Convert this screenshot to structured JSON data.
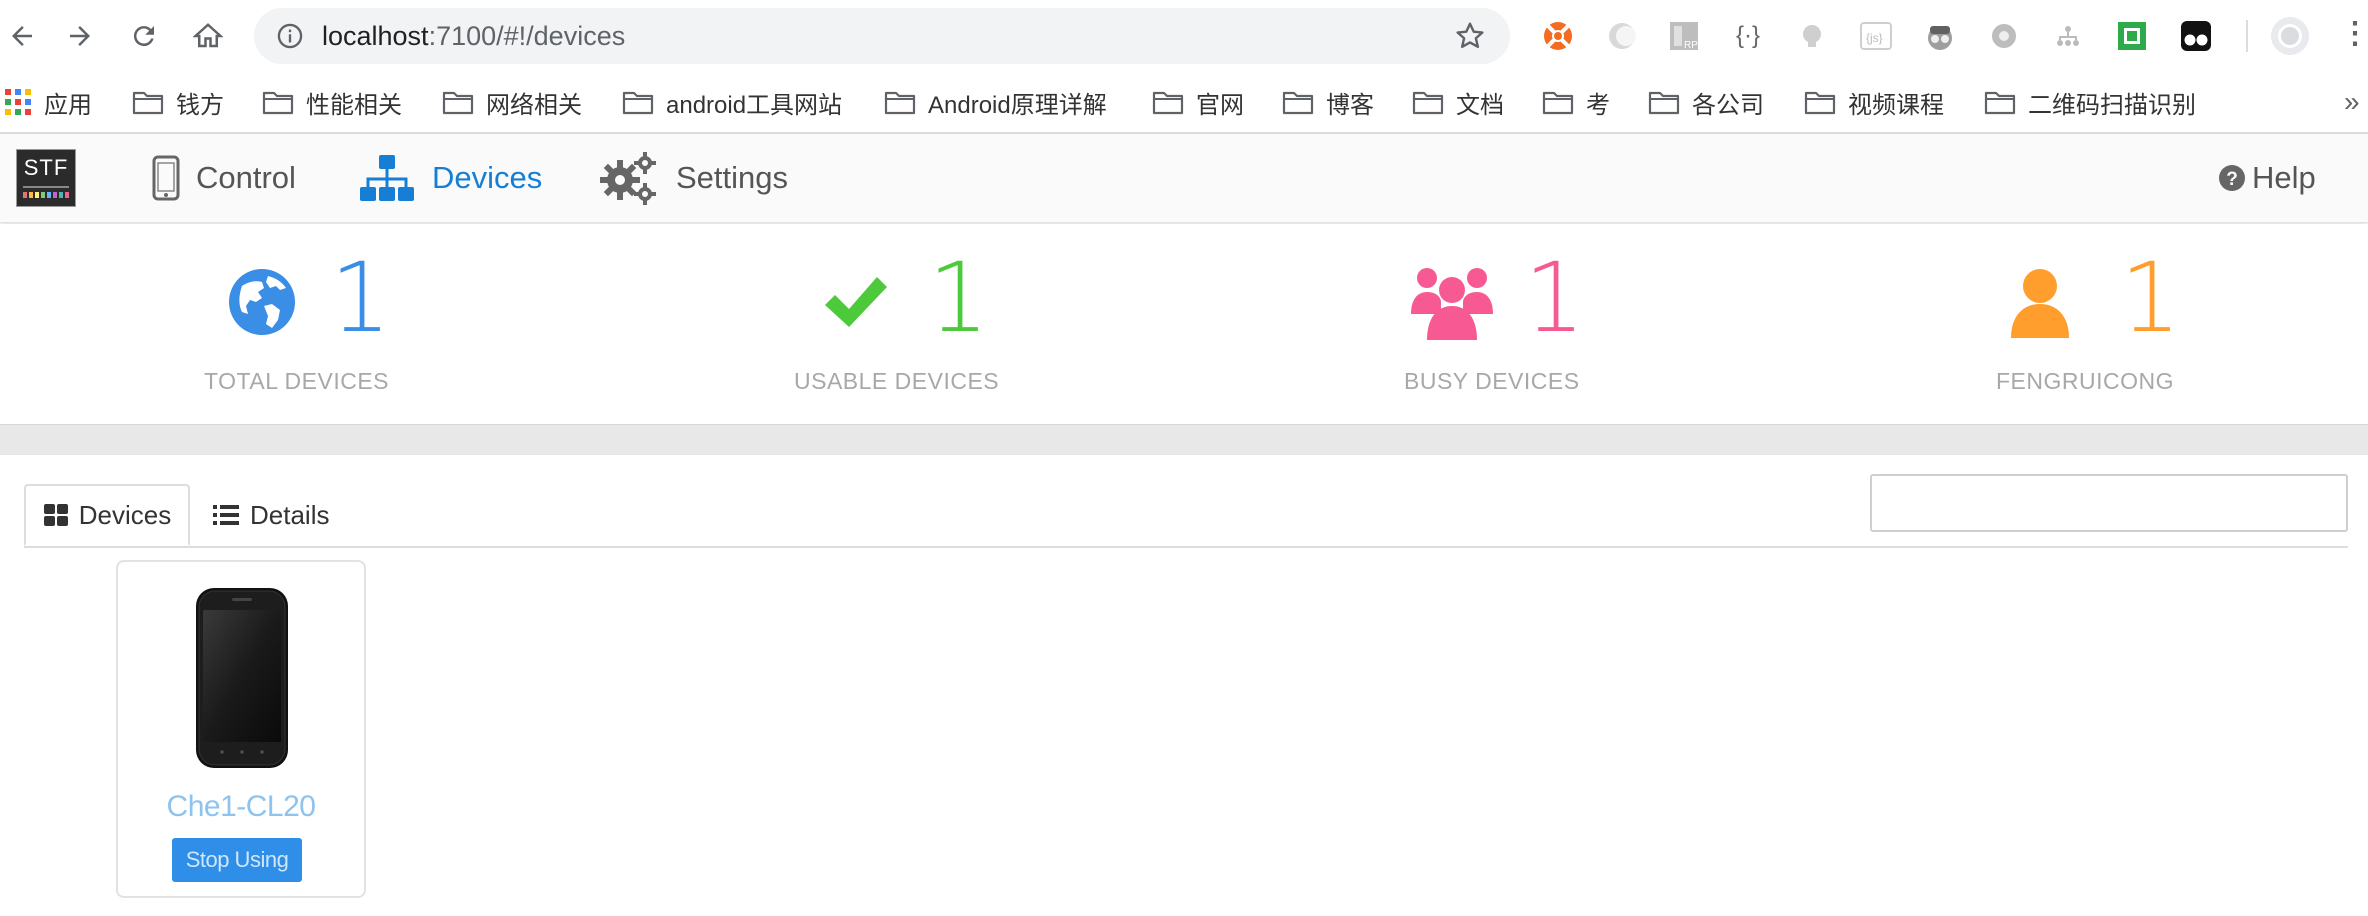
{
  "browser": {
    "url_host": "localhost",
    "url_rest": ":7100/#!/devices",
    "bookmarks": [
      {
        "label": "应用"
      },
      {
        "label": "钱方"
      },
      {
        "label": "性能相关"
      },
      {
        "label": "网络相关"
      },
      {
        "label": "android工具网站"
      },
      {
        "label": "Android原理详解"
      },
      {
        "label": "官网"
      },
      {
        "label": "博客"
      },
      {
        "label": "文档"
      },
      {
        "label": "考"
      },
      {
        "label": "各公司"
      },
      {
        "label": "视频课程"
      },
      {
        "label": "二维码扫描识别"
      }
    ],
    "more": "»"
  },
  "navbar": {
    "logo_text": "STF",
    "items": [
      {
        "label": "Control",
        "icon": "phone-icon"
      },
      {
        "label": "Devices",
        "icon": "sitemap-icon"
      },
      {
        "label": "Settings",
        "icon": "gears-icon"
      }
    ],
    "help_label": "Help"
  },
  "stats": [
    {
      "value": "1",
      "label": "TOTAL DEVICES",
      "color": "#3a8ee6"
    },
    {
      "value": "1",
      "label": "USABLE DEVICES",
      "color": "#4cca3c"
    },
    {
      "value": "1",
      "label": "BUSY DEVICES",
      "color": "#f75a92"
    },
    {
      "value": "1",
      "label": "FENGRUICONG",
      "color": "#ff9e2c"
    }
  ],
  "tabs": {
    "devices_label": "Devices",
    "details_label": "Details"
  },
  "search": {
    "value": "",
    "placeholder": ""
  },
  "device": {
    "name": "Che1-CL20",
    "button_label": "Stop Using"
  }
}
